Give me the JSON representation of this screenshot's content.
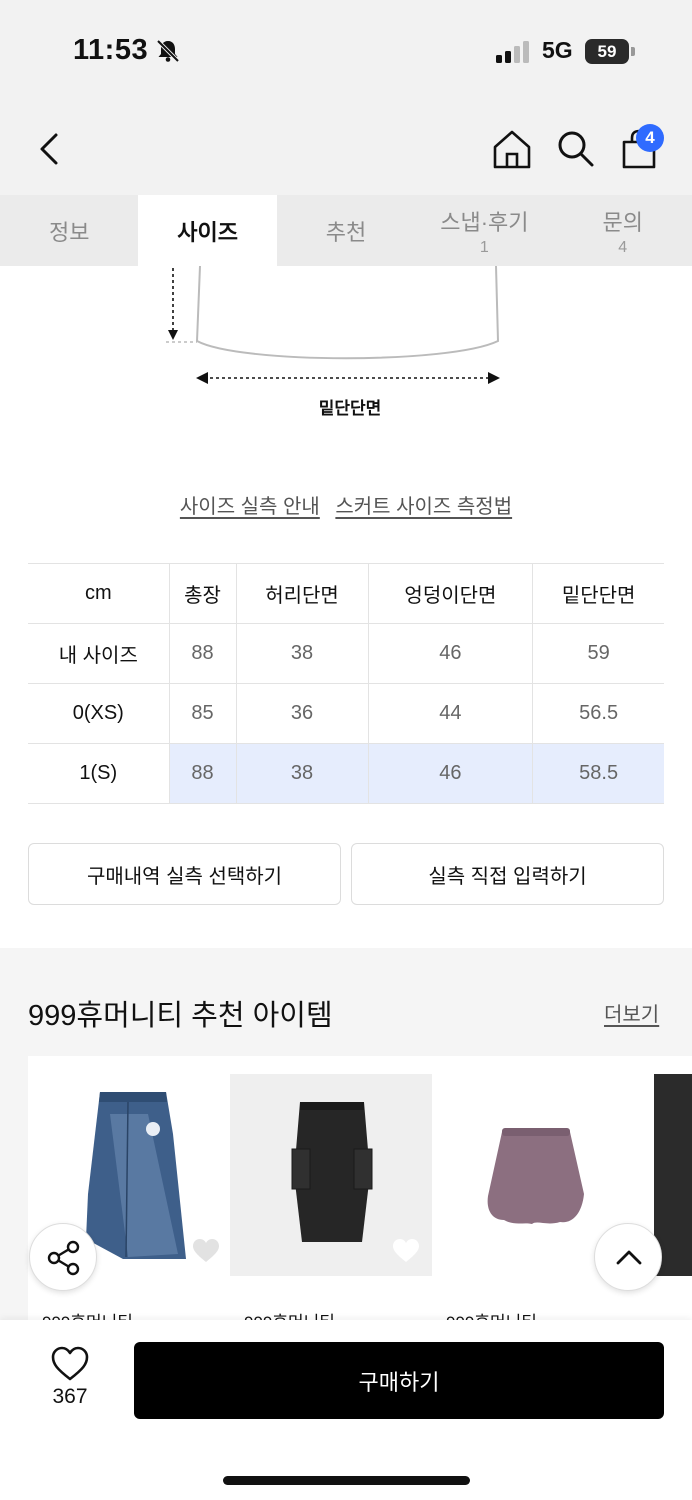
{
  "status_bar": {
    "time": "11:53",
    "network": "5G",
    "battery": "59"
  },
  "header": {
    "cart_count": "4"
  },
  "tabs": [
    {
      "label": "정보",
      "count": ""
    },
    {
      "label": "사이즈",
      "count": ""
    },
    {
      "label": "추천",
      "count": ""
    },
    {
      "label": "스냅·후기",
      "count": "1"
    },
    {
      "label": "문의",
      "count": "4"
    }
  ],
  "diagram": {
    "label": "밑단단면"
  },
  "links": {
    "size_guide": "사이즈 실측 안내",
    "skirt_measure": "스커트 사이즈 측정법"
  },
  "size_table": {
    "headers": [
      "cm",
      "총장",
      "허리단면",
      "엉덩이단면",
      "밑단단면"
    ],
    "rows": [
      [
        "내 사이즈",
        "88",
        "38",
        "46",
        "59"
      ],
      [
        "0(XS)",
        "85",
        "36",
        "44",
        "56.5"
      ],
      [
        "1(S)",
        "88",
        "38",
        "46",
        "58.5"
      ]
    ]
  },
  "buttons": {
    "select_history": "구매내역 실측 선택하기",
    "enter_direct": "실측 직접 입력하기"
  },
  "recommend": {
    "title": "999휴머니티 추천 아이템",
    "more": "더보기",
    "brand": "999휴머니티"
  },
  "bottom": {
    "like_count": "367",
    "buy_label": "구매하기"
  }
}
